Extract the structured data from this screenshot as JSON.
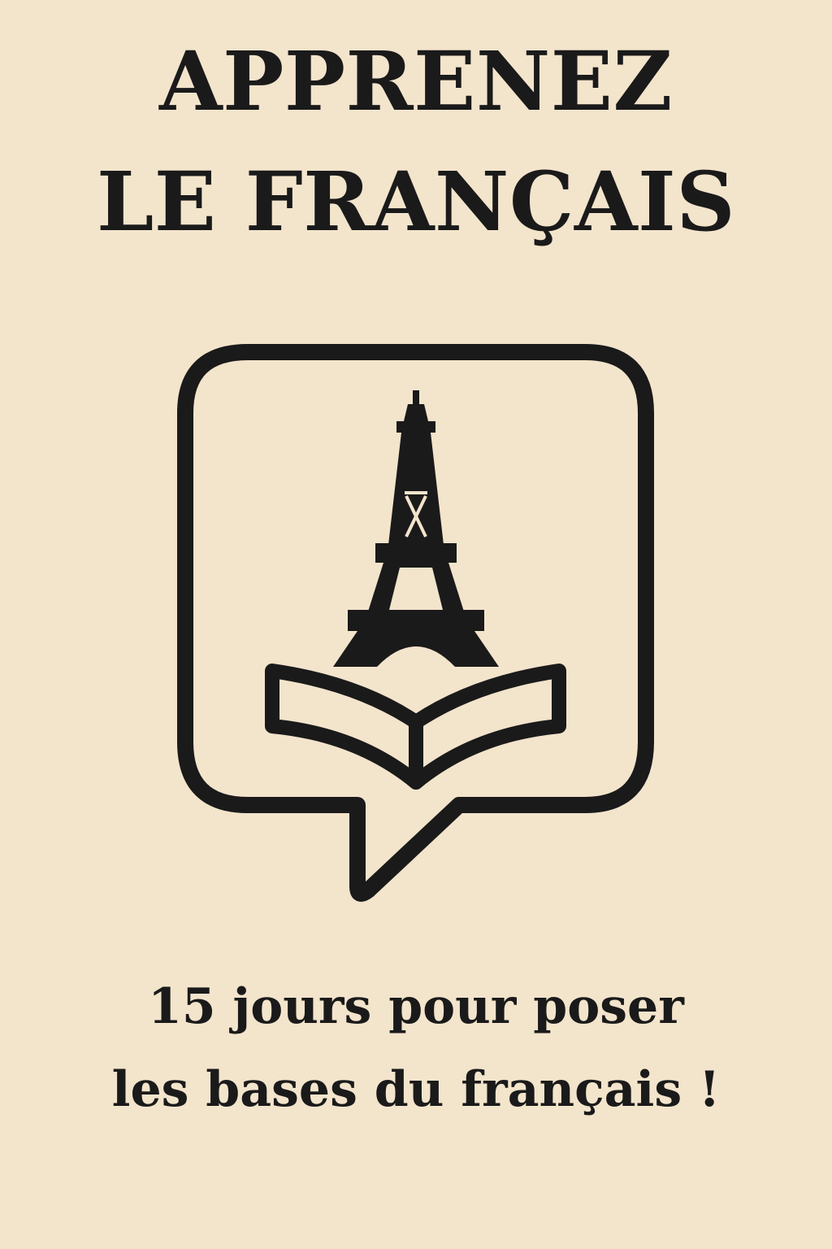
{
  "header": {
    "title_line_1": "APPRENEZ",
    "title_line_2": "LE FRANÇAIS"
  },
  "emblem": {
    "icons": [
      "speech-bubble-icon",
      "eiffel-tower-icon",
      "open-book-icon"
    ]
  },
  "footer": {
    "subtitle_line_1": "15 jours pour poser",
    "subtitle_line_2": "les bases du français !"
  },
  "colors": {
    "background": "#f3e4cc",
    "ink": "#1a1a1a"
  }
}
